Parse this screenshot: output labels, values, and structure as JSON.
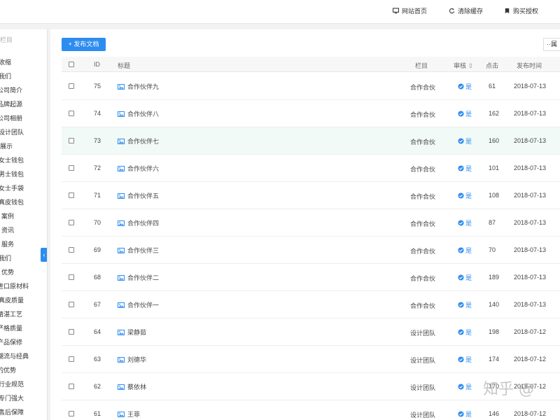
{
  "topbar": {
    "items": [
      {
        "label": "网站首页",
        "icon": "monitor-icon"
      },
      {
        "label": "清除缓存",
        "icon": "refresh-icon"
      },
      {
        "label": "购买授权",
        "icon": "bookmark-icon"
      }
    ]
  },
  "sidebar": {
    "search_text": "栏目",
    "items": [
      "收缩",
      "我们",
      "公司简介",
      "品牌起源",
      "公司相册",
      "设计团队",
      "展示",
      "女士钱包",
      "男士钱包",
      "女士手袋",
      "真皮钱包",
      "案例",
      "资讯",
      "服务",
      "我们",
      "优势",
      "进口原材料",
      "真皮质量",
      "精湛工艺",
      "严格质量",
      "产品保修",
      "潮流与经典",
      "的优势",
      "行业规范",
      "专门强大",
      "售后保障"
    ],
    "collapse_icon": "chevron-left-icon"
  },
  "toolbar": {
    "publish_label": "+ 发布文档",
    "more_label": "··属"
  },
  "table": {
    "headers": {
      "id": "ID",
      "title": "标题",
      "column": "栏目",
      "audit": "审核",
      "audit_sort": "⇕",
      "clicks": "点击",
      "time": "发布时间"
    },
    "rows": [
      {
        "id": "75",
        "title": "合作伙伴九",
        "column": "合作合伙",
        "audit": "是",
        "clicks": "61",
        "time": "2018-07-13"
      },
      {
        "id": "74",
        "title": "合作伙伴八",
        "column": "合作合伙",
        "audit": "是",
        "clicks": "162",
        "time": "2018-07-13"
      },
      {
        "id": "73",
        "title": "合作伙伴七",
        "column": "合作合伙",
        "audit": "是",
        "clicks": "160",
        "time": "2018-07-13"
      },
      {
        "id": "72",
        "title": "合作伙伴六",
        "column": "合作合伙",
        "audit": "是",
        "clicks": "101",
        "time": "2018-07-13"
      },
      {
        "id": "71",
        "title": "合作伙伴五",
        "column": "合作合伙",
        "audit": "是",
        "clicks": "108",
        "time": "2018-07-13"
      },
      {
        "id": "70",
        "title": "合作伙伴四",
        "column": "合作合伙",
        "audit": "是",
        "clicks": "87",
        "time": "2018-07-13"
      },
      {
        "id": "69",
        "title": "合作伙伴三",
        "column": "合作合伙",
        "audit": "是",
        "clicks": "70",
        "time": "2018-07-13"
      },
      {
        "id": "68",
        "title": "合作伙伴二",
        "column": "合作合伙",
        "audit": "是",
        "clicks": "189",
        "time": "2018-07-13"
      },
      {
        "id": "67",
        "title": "合作伙伴一",
        "column": "合作合伙",
        "audit": "是",
        "clicks": "140",
        "time": "2018-07-13"
      },
      {
        "id": "64",
        "title": "梁静茹",
        "column": "设计团队",
        "audit": "是",
        "clicks": "198",
        "time": "2018-07-12"
      },
      {
        "id": "63",
        "title": "刘德华",
        "column": "设计团队",
        "audit": "是",
        "clicks": "174",
        "time": "2018-07-12"
      },
      {
        "id": "62",
        "title": "蔡依林",
        "column": "设计团队",
        "audit": "是",
        "clicks": "170",
        "time": "2018-07-12"
      },
      {
        "id": "61",
        "title": "王菲",
        "column": "设计团队",
        "audit": "是",
        "clicks": "146",
        "time": "2018-07-12"
      }
    ]
  },
  "watermark": "知乎 @",
  "colors": {
    "accent": "#2d8cf0",
    "highlight_row": "#f1faf6"
  }
}
